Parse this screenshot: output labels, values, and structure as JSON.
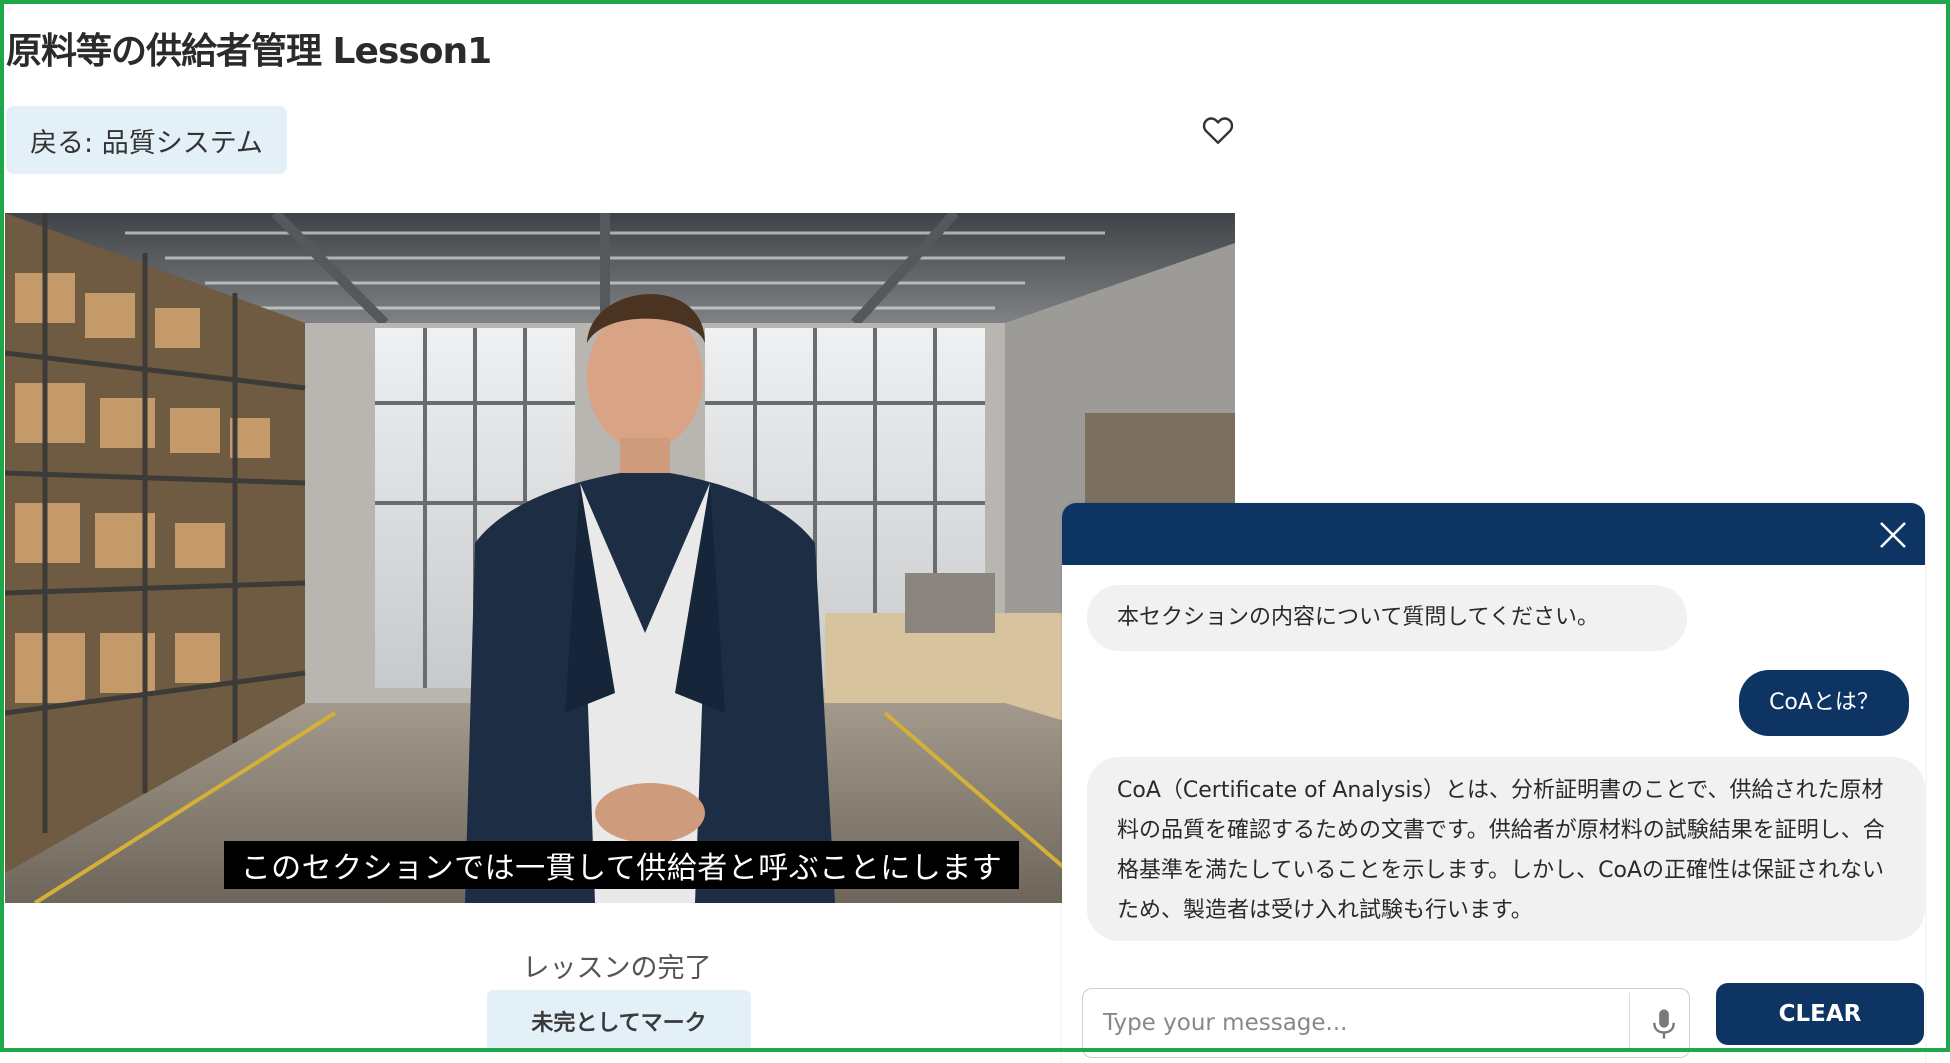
{
  "page": {
    "title": "原料等の供給者管理 Lesson1",
    "back_label": "戻る: 品質システム",
    "lesson_complete_label": "レッスンの完了",
    "mark_incomplete_label": "未完としてマーク"
  },
  "video": {
    "subtitle": "このセクションでは一貫して供給者と呼ぶことにします"
  },
  "chat": {
    "messages": [
      {
        "role": "bot",
        "text": "本セクションの内容について質問してください。"
      },
      {
        "role": "user",
        "text": "CoAとは？"
      },
      {
        "role": "bot",
        "text": "CoA（Certificate of Analysis）とは、分析証明書のことで、供給された原材料の品質を確認するための文書です。供給者が原材料の試験結果を証明し、合格基準を満たしていることを示します。しかし、CoAの正確性は保証されないため、製造者は受け入れ試験も行います。"
      }
    ],
    "input_placeholder": "Type your message...",
    "clear_label": "CLEAR"
  },
  "colors": {
    "accent_navy": "#0e3463",
    "light_button": "#e3f0f8",
    "frame_green": "#1ea84a"
  },
  "icons": [
    "heart-icon",
    "close-icon",
    "microphone-icon"
  ]
}
